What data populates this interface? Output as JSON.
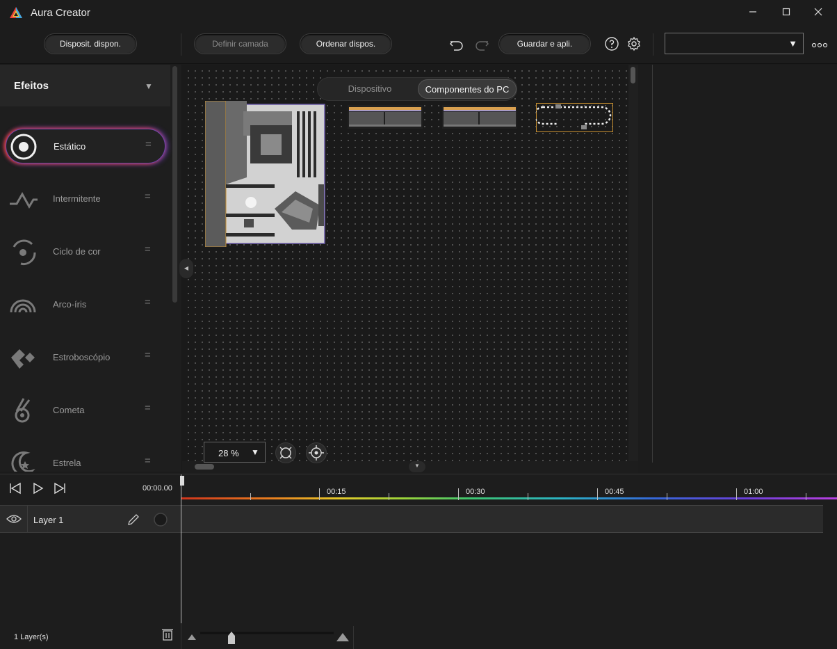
{
  "app": {
    "title": "Aura Creator"
  },
  "toolbar": {
    "available_devices": "Disposit. dispon.",
    "set_layer": "Definir camada",
    "sort_devices": "Ordenar dispos.",
    "save_apply": "Guardar e apli.",
    "device_select_value": ""
  },
  "effects": {
    "title": "Efeitos",
    "items": [
      {
        "label": "Estático",
        "icon": "static-icon",
        "active": true
      },
      {
        "label": "Intermitente",
        "icon": "breathing-icon"
      },
      {
        "label": "Ciclo de cor",
        "icon": "color-cycle-icon"
      },
      {
        "label": "Arco-íris",
        "icon": "rainbow-icon"
      },
      {
        "label": "Estroboscópio",
        "icon": "strobe-icon"
      },
      {
        "label": "Cometa",
        "icon": "comet-icon"
      },
      {
        "label": "Estrela",
        "icon": "star-icon"
      }
    ]
  },
  "canvas": {
    "tabs": [
      {
        "label": "Dispositivo",
        "selected": false
      },
      {
        "label": "Componentes do PC",
        "selected": true
      }
    ],
    "zoom": "28 %"
  },
  "timeline": {
    "current_time": "00:00.00",
    "marks": [
      "00:15",
      "00:30",
      "00:45",
      "01:00"
    ],
    "layers": [
      {
        "name": "Layer 1"
      }
    ],
    "layers_count": "1 Layer(s)"
  },
  "colors": {
    "accent_purple": "#6b47a8",
    "accent_red": "#ff4040"
  }
}
